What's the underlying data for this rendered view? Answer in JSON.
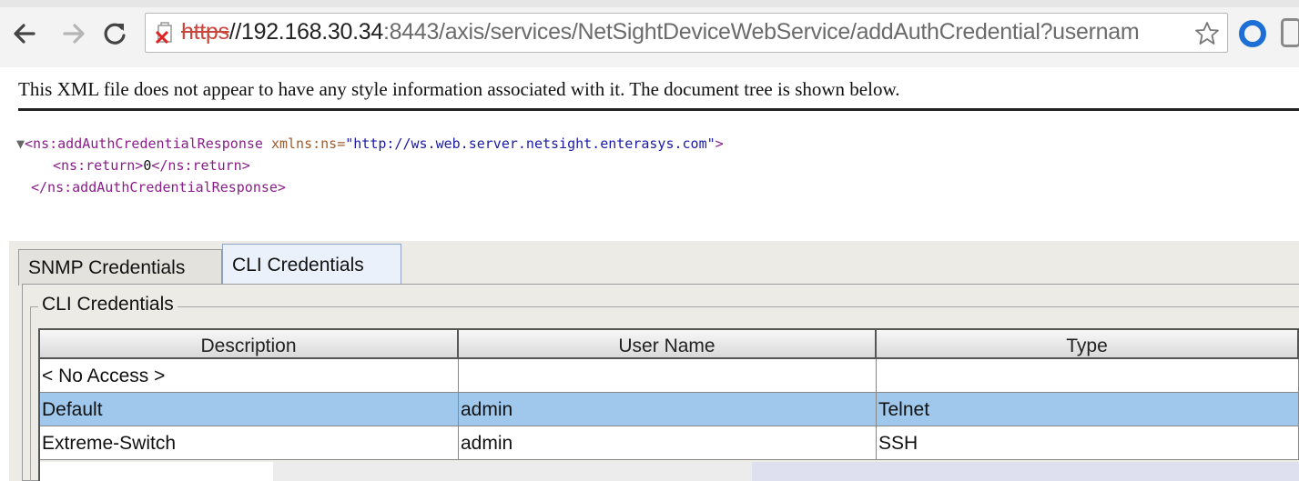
{
  "browser": {
    "url_scheme": "https",
    "url_host": "//192.168.30.34",
    "url_rest": ":8443/axis/services/NetSightDeviceWebService/addAuthCredential?usernam",
    "icons": [
      "back-arrow-icon",
      "forward-arrow-icon",
      "reload-icon",
      "insecure-lock-icon",
      "bookmark-star-icon",
      "opera-extension-icon",
      "extension-icon"
    ]
  },
  "xml_viewer": {
    "notice": "This XML file does not appear to have any style information associated with it. The document tree is shown below.",
    "line1_triangle": "▼",
    "line1_open": "<ns:addAuthCredentialResponse ",
    "line1_attr": "xmlns:ns=",
    "line1_val": "\"http://ws.web.server.netsight.enterasys.com\"",
    "line1_close": ">",
    "line2_open": "<ns:return>",
    "line2_text": "0",
    "line2_close": "</ns:return>",
    "line3": "</ns:addAuthCredentialResponse>"
  },
  "tabs": {
    "snmp": "SNMP Credentials",
    "cli": "CLI Credentials"
  },
  "group": {
    "label": "CLI Credentials"
  },
  "table": {
    "headers": [
      "Description",
      "User Name",
      "Type"
    ],
    "rows": [
      [
        "< No Access >",
        "",
        ""
      ],
      [
        "Default",
        "admin",
        "Telnet"
      ],
      [
        "Extreme-Switch",
        "admin",
        "SSH"
      ]
    ],
    "selected_row": 1
  },
  "colors": {
    "selection": "#9fc8ec",
    "insecure_scheme": "#c8463c",
    "xml_tag": "#8a1e8a",
    "xml_value": "#1a1aa6"
  }
}
